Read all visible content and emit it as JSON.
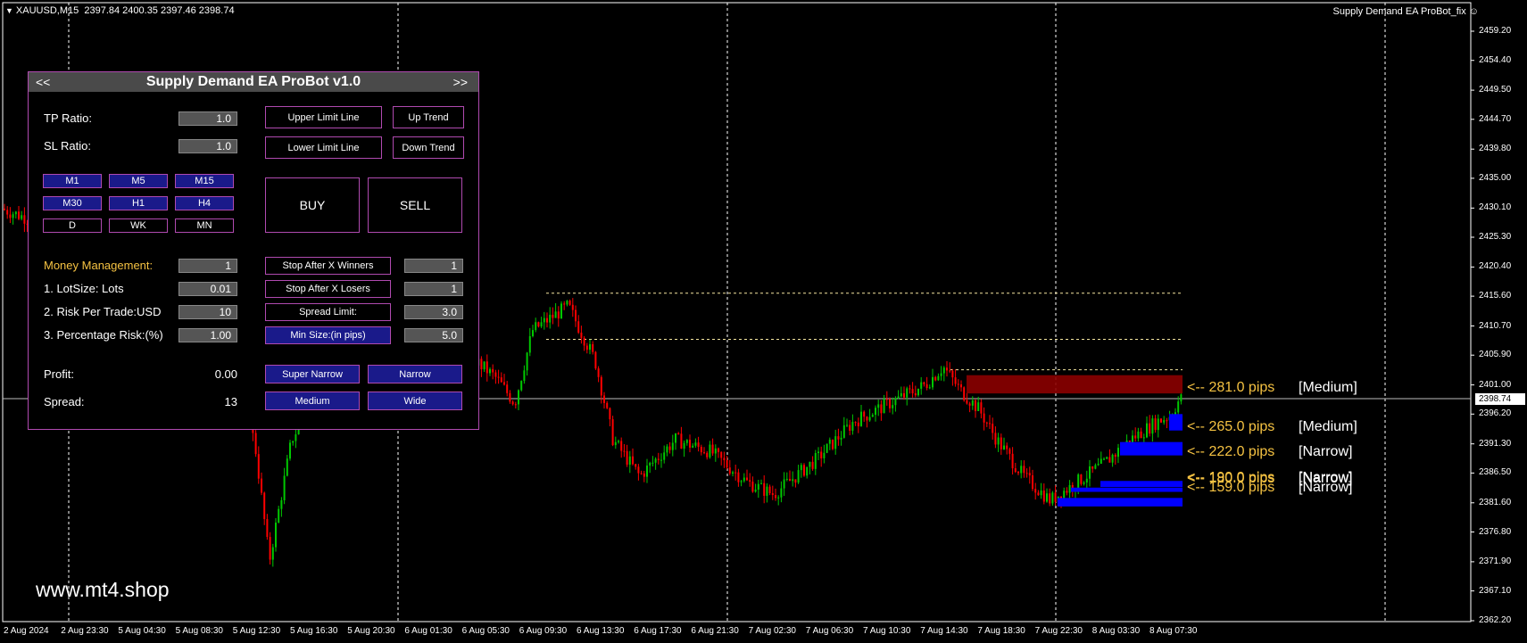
{
  "chart": {
    "symbol": "XAUUSD,M15",
    "ohlc": "2397.84 2400.35 2397.46 2398.74",
    "ea_name": "Supply Demand EA ProBot_fix",
    "watermark": "www.mt4.shop",
    "current_price": "2398.74",
    "price_ticks": [
      {
        "label": "2459.20",
        "price": 2459.2
      },
      {
        "label": "2454.40",
        "price": 2454.4
      },
      {
        "label": "2449.50",
        "price": 2449.5
      },
      {
        "label": "2444.70",
        "price": 2444.7
      },
      {
        "label": "2439.80",
        "price": 2439.8
      },
      {
        "label": "2435.00",
        "price": 2435.0
      },
      {
        "label": "2430.10",
        "price": 2430.1
      },
      {
        "label": "2425.30",
        "price": 2425.3
      },
      {
        "label": "2420.40",
        "price": 2420.4
      },
      {
        "label": "2415.60",
        "price": 2415.6
      },
      {
        "label": "2410.70",
        "price": 2410.7
      },
      {
        "label": "2405.90",
        "price": 2405.9
      },
      {
        "label": "2401.00",
        "price": 2401.0
      },
      {
        "label": "2396.20",
        "price": 2396.2
      },
      {
        "label": "2391.30",
        "price": 2391.3
      },
      {
        "label": "2386.50",
        "price": 2386.5
      },
      {
        "label": "2381.60",
        "price": 2381.6
      },
      {
        "label": "2376.80",
        "price": 2376.8
      },
      {
        "label": "2371.90",
        "price": 2371.9
      },
      {
        "label": "2367.10",
        "price": 2367.1
      },
      {
        "label": "2362.20",
        "price": 2362.2
      }
    ],
    "time_labels": [
      "2 Aug 2024",
      "2 Aug 23:30",
      "5 Aug 04:30",
      "5 Aug 08:30",
      "5 Aug 12:30",
      "5 Aug 16:30",
      "5 Aug 20:30",
      "6 Aug 01:30",
      "6 Aug 05:30",
      "6 Aug 09:30",
      "6 Aug 13:30",
      "6 Aug 17:30",
      "6 Aug 21:30",
      "7 Aug 02:30",
      "7 Aug 06:30",
      "7 Aug 10:30",
      "7 Aug 14:30",
      "7 Aug 18:30",
      "7 Aug 22:30",
      "8 Aug 03:30",
      "8 Aug 07:30"
    ],
    "zones": [
      {
        "pips": "<-- 281.0 pips",
        "class": "[Medium]",
        "color": "#8b0000"
      },
      {
        "pips": "<-- 265.0 pips",
        "class": "[Medium]",
        "color": "#0000ff"
      },
      {
        "pips": "<-- 222.0 pips",
        "class": "[Narrow]",
        "color": "#0000ff"
      },
      {
        "pips": "<-- 190.0 pips",
        "class": "[Narrow]",
        "color": "#0000ff"
      },
      {
        "pips": "<-- 180.0 pips",
        "class": "[Narrow]",
        "color": "#0000ff"
      },
      {
        "pips": "<-- 159.0 pips",
        "class": "[Narrow]",
        "color": "#0000ff"
      }
    ],
    "colors": {
      "bull": "#00c800",
      "bear": "#ff0000",
      "grid": "#ffffff",
      "supply_zone": "#8b0000",
      "demand_zone": "#0000ff",
      "label_gold": "#f5c242"
    }
  },
  "panel": {
    "title": "Supply Demand EA ProBot v1.0",
    "nav_left": "<<",
    "nav_right": ">>",
    "tp_ratio_label": "TP Ratio:",
    "tp_ratio_value": "1.0",
    "sl_ratio_label": "SL Ratio:",
    "sl_ratio_value": "1.0",
    "timeframes": [
      "M1",
      "M5",
      "M15",
      "M30",
      "H1",
      "H4",
      "D",
      "WK",
      "MN"
    ],
    "upper_limit_line": "Upper Limit Line",
    "lower_limit_line": "Lower Limit Line",
    "up_trend": "Up Trend",
    "down_trend": "Down Trend",
    "buy": "BUY",
    "sell": "SELL",
    "money_mgmt_label": "Money Management:",
    "money_mgmt_value": "1",
    "lot_size_label": "1. LotSize: Lots",
    "lot_size_value": "0.01",
    "risk_trade_label": "2. Risk Per Trade:USD",
    "risk_trade_value": "10",
    "pct_risk_label": "3. Percentage Risk:(%)",
    "pct_risk_value": "1.00",
    "stop_winners_label": "Stop After X Winners",
    "stop_winners_value": "1",
    "stop_losers_label": "Stop After X Losers",
    "stop_losers_value": "1",
    "spread_limit_label": "Spread Limit:",
    "spread_limit_value": "3.0",
    "min_size_label": "Min Size:(in pips)",
    "min_size_value": "5.0",
    "profit_label": "Profit:",
    "profit_value": "0.00",
    "spread_label": "Spread:",
    "spread_value": "13",
    "super_narrow": "Super Narrow",
    "narrow": "Narrow",
    "medium": "Medium",
    "wide": "Wide"
  }
}
